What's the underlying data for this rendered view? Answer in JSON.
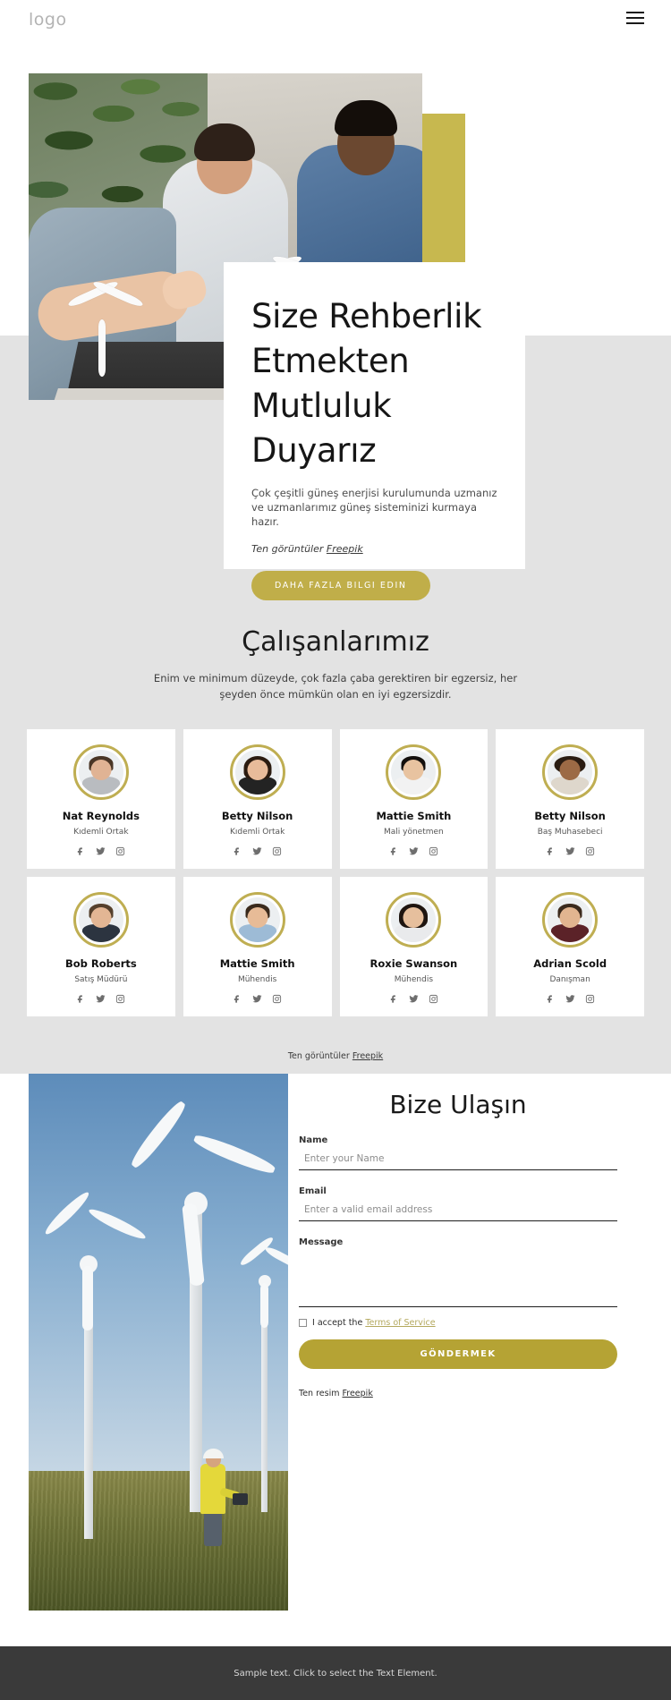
{
  "header": {
    "logo": "logo",
    "menu_icon": "hamburger-menu-icon"
  },
  "hero": {
    "title": "Size Rehberlik Etmekten Mutluluk Duyarız",
    "subtitle": "Çok çeşitli güneş enerjisi kurulumunda uzmanız ve uzmanlarımız güneş sisteminizi kurmaya hazır.",
    "credit_prefix": "Ten görüntüler ",
    "credit_link": "Freepik",
    "cta_label": "DAHA FAZLA BILGI EDIN",
    "accent_color": "#c7b84f"
  },
  "team": {
    "title": "Çalışanlarımız",
    "subtitle": "Enim ve minimum düzeyde, çok fazla çaba gerektiren bir egzersiz, her şeyden önce mümkün olan en iyi egzersizdir.",
    "credit_prefix": "Ten görüntüler ",
    "credit_link": "Freepik",
    "members": [
      {
        "name": "Nat Reynolds",
        "role": "Kıdemli Ortak"
      },
      {
        "name": "Betty Nilson",
        "role": "Kıdemli Ortak"
      },
      {
        "name": "Mattie Smith",
        "role": "Mali yönetmen"
      },
      {
        "name": "Betty Nilson",
        "role": "Baş Muhasebeci"
      },
      {
        "name": "Bob Roberts",
        "role": "Satış Müdürü"
      },
      {
        "name": "Mattie Smith",
        "role": "Mühendis"
      },
      {
        "name": "Roxie Swanson",
        "role": "Mühendis"
      },
      {
        "name": "Adrian Scold",
        "role": "Danışman"
      }
    ],
    "social_icons": [
      "facebook-icon",
      "twitter-icon",
      "instagram-icon"
    ],
    "ring_color": "#bfae52"
  },
  "contact": {
    "title": "Bize Ulaşın",
    "name_label": "Name",
    "name_placeholder": "Enter your Name",
    "name_value": "",
    "email_label": "Email",
    "email_placeholder": "Enter a valid email address",
    "email_value": "",
    "message_label": "Message",
    "message_placeholder": "",
    "message_value": "",
    "accept_text": "I accept the ",
    "terms_label": "Terms of Service",
    "submit_label": "GÖNDERMEK",
    "credit_prefix": "Ten resim ",
    "credit_link": "Freepik",
    "button_color": "#b5a334"
  },
  "footer": {
    "text": "Sample text. Click to select the Text Element."
  }
}
